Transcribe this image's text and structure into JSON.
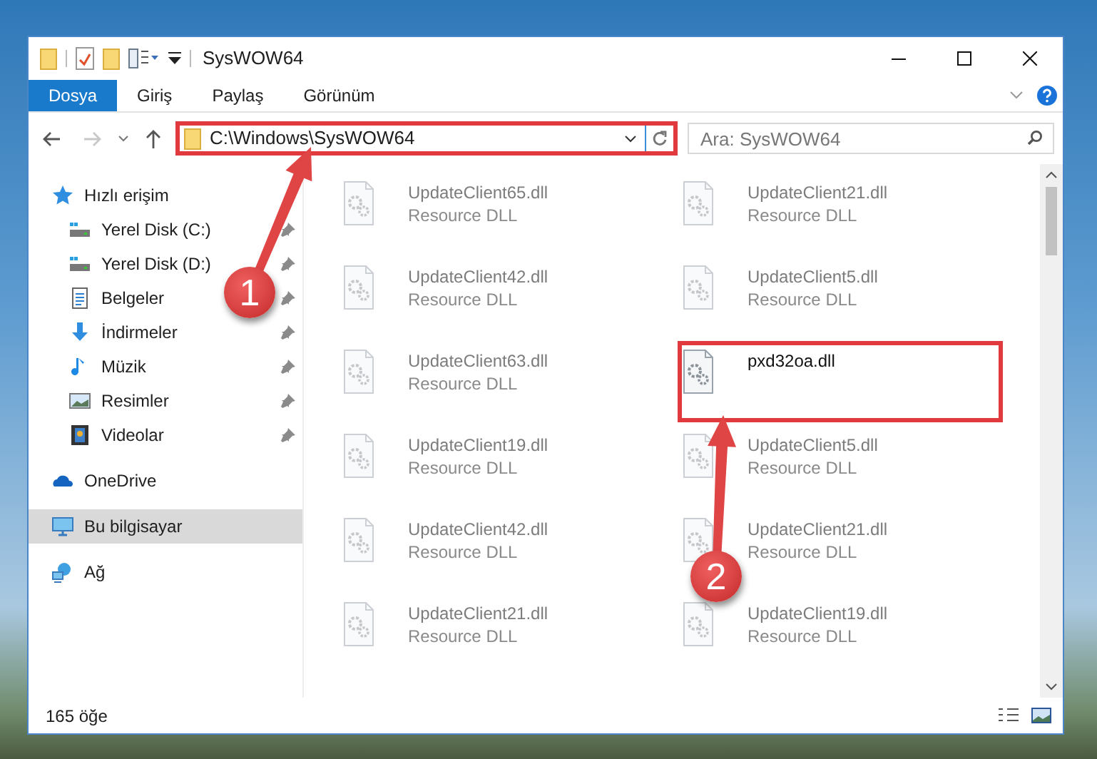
{
  "window": {
    "title": "SysWOW64"
  },
  "ribbon_tabs": [
    {
      "label": "Dosya",
      "kind": "file"
    },
    {
      "label": "Giriş",
      "kind": "tab"
    },
    {
      "label": "Paylaş",
      "kind": "tab"
    },
    {
      "label": "Görünüm",
      "kind": "tab"
    }
  ],
  "address_bar": {
    "path": "C:\\Windows\\SysWOW64",
    "highlighted": true
  },
  "search": {
    "placeholder": "Ara: SysWOW64"
  },
  "navigation": [
    {
      "label": "Hızlı erişim",
      "kind": "star",
      "selected": false,
      "children": [
        {
          "label": "Yerel Disk (C:)",
          "kind": "drive",
          "pinned": true,
          "selected": false
        },
        {
          "label": "Yerel Disk (D:)",
          "kind": "drive",
          "pinned": true,
          "selected": false
        },
        {
          "label": "Belgeler",
          "kind": "document",
          "pinned": true,
          "selected": false
        },
        {
          "label": "İndirmeler",
          "kind": "download",
          "pinned": true,
          "selected": false
        },
        {
          "label": "Müzik",
          "kind": "music",
          "pinned": true,
          "selected": false
        },
        {
          "label": "Resimler",
          "kind": "picture",
          "pinned": true,
          "selected": false
        },
        {
          "label": "Videolar",
          "kind": "video",
          "pinned": true,
          "selected": false
        }
      ]
    },
    {
      "label": "OneDrive",
      "kind": "cloud",
      "selected": false
    },
    {
      "label": "Bu bilgisayar",
      "kind": "computer",
      "selected": true
    },
    {
      "label": "Ağ",
      "kind": "network",
      "selected": false
    }
  ],
  "files": [
    {
      "name": "UpdateClient65.dll",
      "type": "Resource DLL",
      "blurred": true,
      "highlighted": false
    },
    {
      "name": "UpdateClient21.dll",
      "type": "Resource DLL",
      "blurred": true,
      "highlighted": false
    },
    {
      "name": "UpdateClient42.dll",
      "type": "Resource DLL",
      "blurred": true,
      "highlighted": false
    },
    {
      "name": "UpdateClient5.dll",
      "type": "Resource DLL",
      "blurred": true,
      "highlighted": false
    },
    {
      "name": "UpdateClient63.dll",
      "type": "Resource DLL",
      "blurred": true,
      "highlighted": false
    },
    {
      "name": "pxd32oa.dll",
      "blurred": false,
      "highlighted": true
    },
    {
      "name": "UpdateClient19.dll",
      "type": "Resource DLL",
      "blurred": true,
      "highlighted": false
    },
    {
      "name": "UpdateClient5.dll",
      "type": "Resource DLL",
      "blurred": true,
      "highlighted": false
    },
    {
      "name": "UpdateClient42.dll",
      "type": "Resource DLL",
      "blurred": true,
      "highlighted": false
    },
    {
      "name": "UpdateClient21.dll",
      "type": "Resource DLL",
      "blurred": true,
      "highlighted": false
    },
    {
      "name": "UpdateClient21.dll",
      "type": "Resource DLL",
      "blurred": true,
      "highlighted": false
    },
    {
      "name": "UpdateClient19.dll",
      "type": "Resource DLL",
      "blurred": true,
      "highlighted": false
    }
  ],
  "status_bar": {
    "item_count": "165 öğe"
  },
  "callouts": [
    {
      "label": "1"
    },
    {
      "label": "2"
    }
  ]
}
